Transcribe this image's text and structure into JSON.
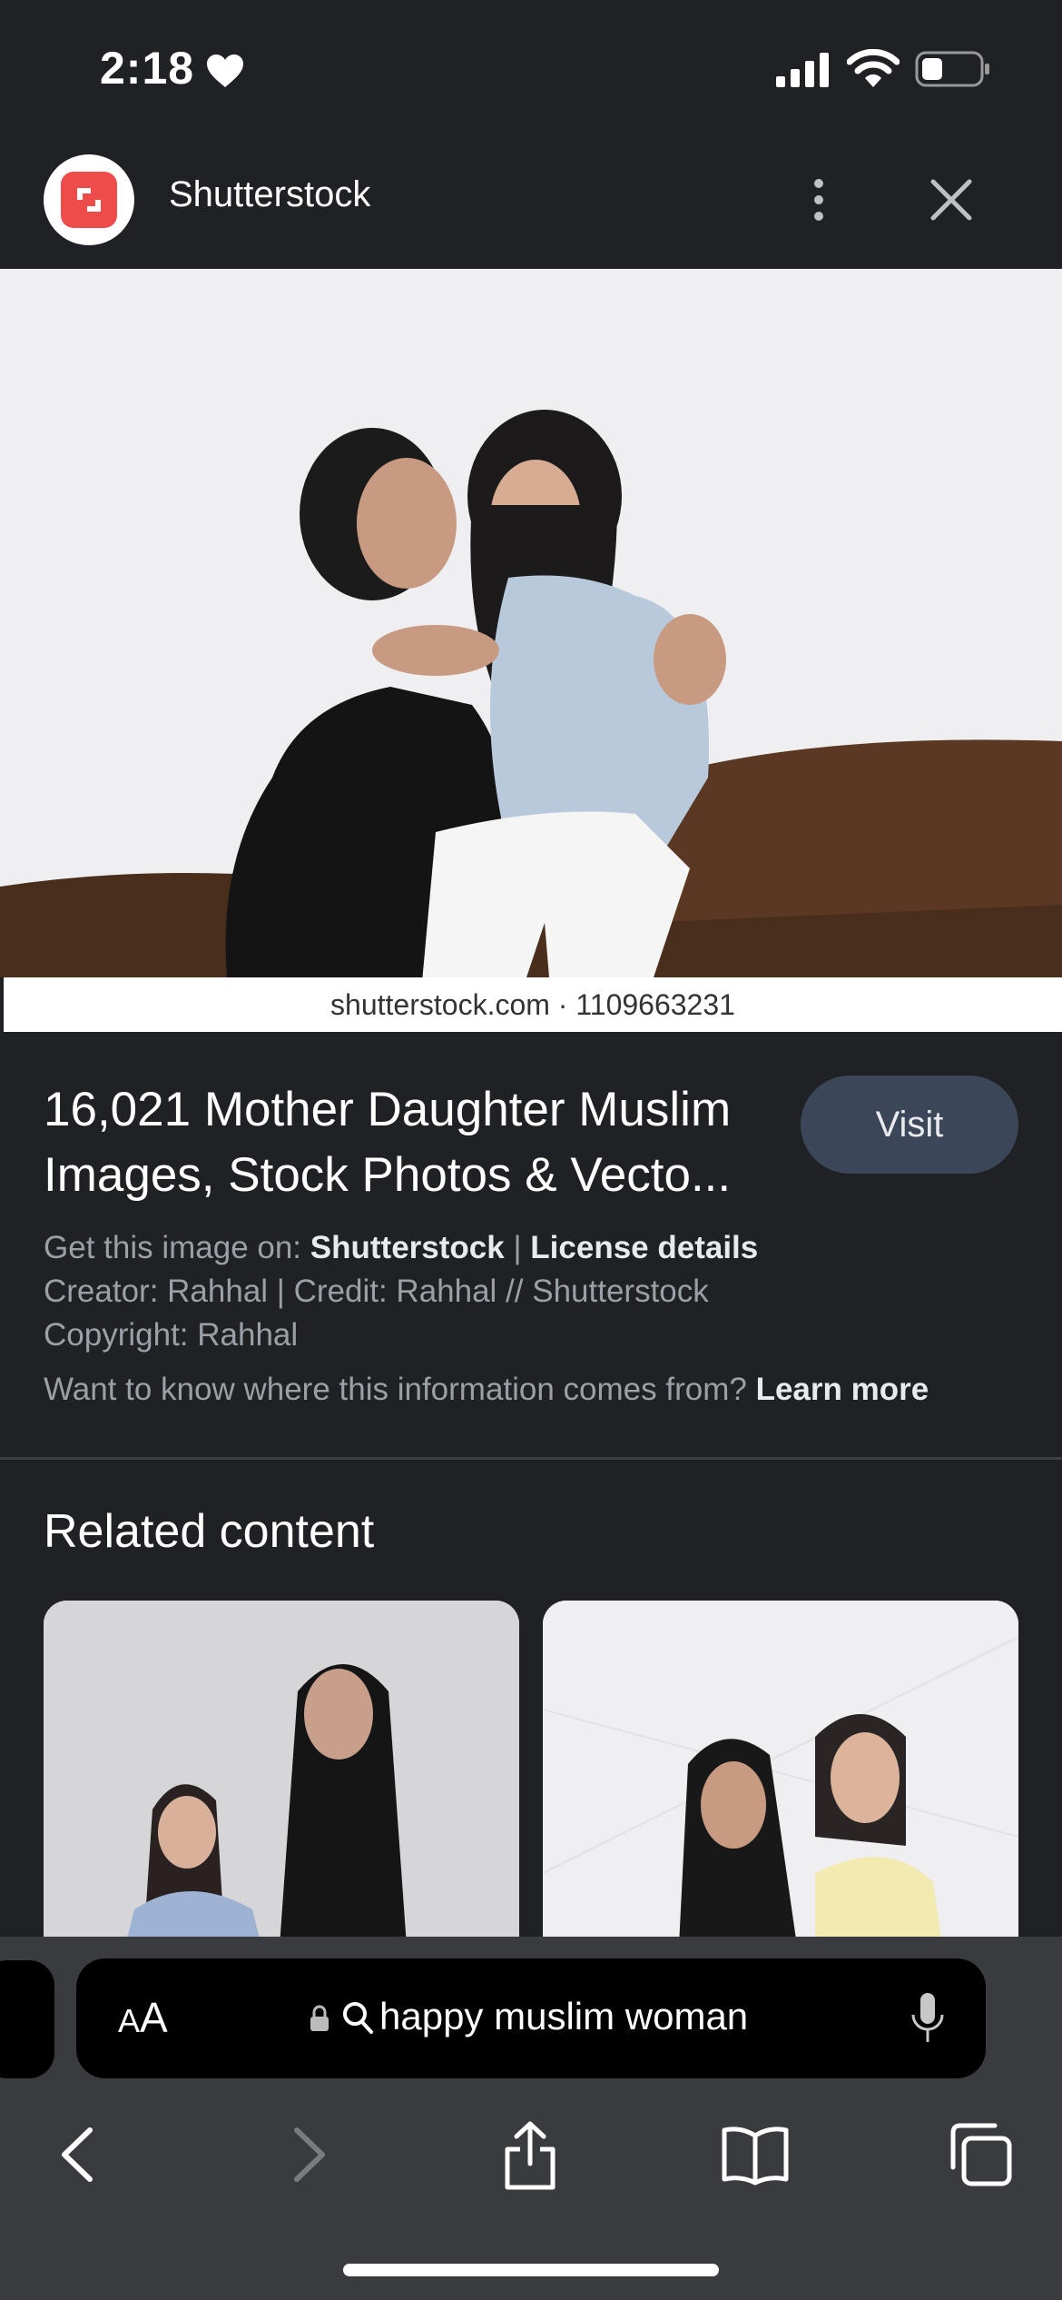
{
  "status_bar": {
    "time": "2:18"
  },
  "header": {
    "site_name": "Shutterstock"
  },
  "image": {
    "watermark": "shutterstock.com · 1109663231"
  },
  "info": {
    "title": "16,021 Mother Daughter Muslim Images, Stock Photos & Vecto...",
    "visit_label": "Visit",
    "get_image_prefix": "Get this image on:",
    "get_image_source": "Shutterstock",
    "separator": "|",
    "license_label": "License details",
    "creator_line": "Creator: Rahhal | Credit: Rahhal // Shutterstock",
    "copyright_line": "Copyright: Rahhal",
    "learn_prefix": "Want to know where this information comes from?",
    "learn_label": "Learn more"
  },
  "related": {
    "title": "Related content"
  },
  "browser": {
    "aa_small": "A",
    "aa_large": "A",
    "query": "happy muslim woman"
  },
  "colors": {
    "background": "#202124",
    "visit_button": "#3c4659",
    "brand": "#ee4b4b"
  }
}
